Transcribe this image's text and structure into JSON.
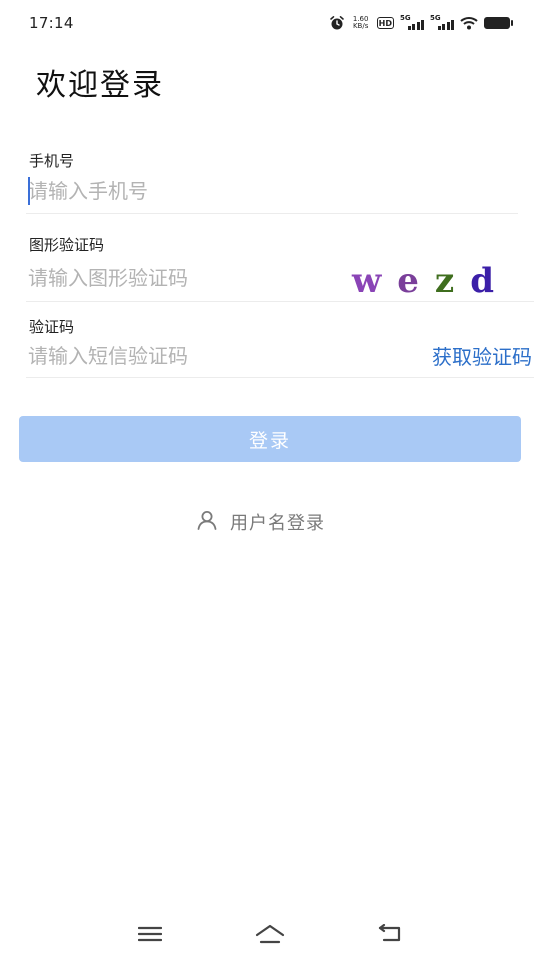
{
  "status_bar": {
    "time": "17:14",
    "net_speed_value": "1.60",
    "net_speed_unit": "KB/s",
    "hd_label": "HD",
    "sim1_label": "5G",
    "sim2_label": "5G",
    "icons": [
      "alarm-icon",
      "hd-icon",
      "signal-icon",
      "wifi-icon",
      "battery-icon"
    ]
  },
  "page": {
    "title": "欢迎登录"
  },
  "form": {
    "phone": {
      "label": "手机号",
      "placeholder": "请输入手机号",
      "value": ""
    },
    "captcha": {
      "label": "图形验证码",
      "placeholder": "请输入图形验证码",
      "value": "",
      "image_chars": [
        "w",
        "e",
        "z",
        "d"
      ],
      "image_colors": [
        "#8a44b6",
        "#7a3f9a",
        "#3f6e1e",
        "#3b1fa8"
      ]
    },
    "sms": {
      "label": "验证码",
      "placeholder": "请输入短信验证码",
      "value": "",
      "get_code_label": "获取验证码"
    },
    "submit_label": "登录"
  },
  "alt_login": {
    "label": "用户名登录",
    "icon": "user-icon"
  },
  "colors": {
    "accent": "#2c6fc9",
    "button_disabled": "#a9c9f5",
    "placeholder": "#b3b3b3",
    "caret": "#3a6fd8"
  },
  "nav_bar": {
    "icons": [
      "menu-icon",
      "home-icon",
      "back-icon"
    ]
  }
}
